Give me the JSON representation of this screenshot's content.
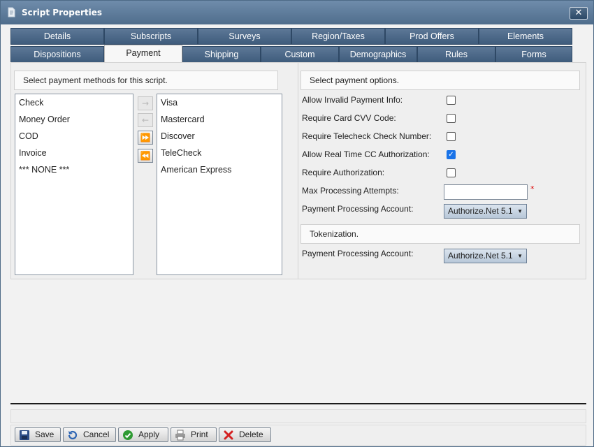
{
  "window": {
    "title": "Script Properties",
    "close_glyph": "✕"
  },
  "tabs_row1": [
    {
      "label": "Details"
    },
    {
      "label": "Subscripts"
    },
    {
      "label": "Surveys"
    },
    {
      "label": "Region/Taxes"
    },
    {
      "label": "Prod Offers"
    },
    {
      "label": "Elements"
    }
  ],
  "tabs_row2": [
    {
      "label": "Dispositions"
    },
    {
      "label": "Payment"
    },
    {
      "label": "Shipping"
    },
    {
      "label": "Custom"
    },
    {
      "label": "Demographics"
    },
    {
      "label": "Rules"
    },
    {
      "label": "Forms"
    }
  ],
  "payment_methods": {
    "header": "Select payment methods for this script.",
    "available": [
      "Check",
      "Money Order",
      "COD",
      "Invoice",
      "*** NONE ***"
    ],
    "selected": [
      "Visa",
      "Mastercard",
      "Discover",
      "TeleCheck",
      "American Express"
    ],
    "buttons": {
      "move_right": "→",
      "move_left": "←",
      "move_all_right": "⏩",
      "move_all_left": "⏪"
    }
  },
  "payment_options": {
    "header": "Select payment options.",
    "allow_invalid": {
      "label": "Allow Invalid Payment Info:",
      "checked": false
    },
    "require_cvv": {
      "label": "Require Card CVV Code:",
      "checked": false
    },
    "require_telecheck": {
      "label": "Require Telecheck Check Number:",
      "checked": false
    },
    "allow_realtime": {
      "label": "Allow Real Time CC Authorization:",
      "checked": true
    },
    "require_auth": {
      "label": "Require Authorization:",
      "checked": false
    },
    "max_attempts": {
      "label": "Max Processing Attempts:",
      "value": "",
      "required_mark": "*"
    },
    "processing_account": {
      "label": "Payment Processing Account:",
      "value": "Authorize.Net 5.1"
    }
  },
  "tokenization": {
    "header": "Tokenization.",
    "processing_account": {
      "label": "Payment Processing Account:",
      "value": "Authorize.Net 5.1"
    }
  },
  "footer": {
    "save": "Save",
    "cancel": "Cancel",
    "apply": "Apply",
    "print": "Print",
    "delete": "Delete"
  },
  "colors": {
    "tab_bg": "#4f6b8a",
    "title_bg": "#5a7898",
    "checkbox_checked": "#1a73e8"
  }
}
